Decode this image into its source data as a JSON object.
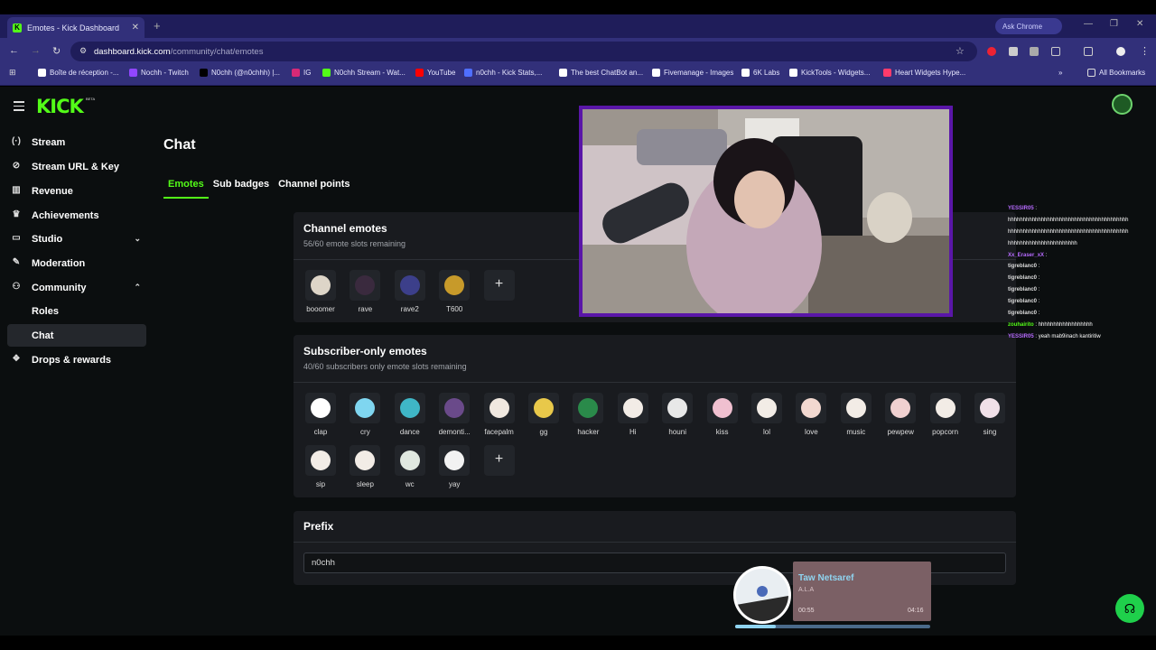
{
  "browser": {
    "tab_title": "Emotes - Kick Dashboard",
    "tab_close": "✕",
    "new_tab": "+",
    "ask_chrome": "Ask Chrome",
    "url_host": "dashboard.kick.com",
    "url_path": "/community/chat/emotes",
    "all_bookmarks": "All Bookmarks",
    "bookmarks": [
      {
        "label": "Boîte de réception -...",
        "color": "#ffffff"
      },
      {
        "label": "Nochh - Twitch",
        "color": "#9146ff"
      },
      {
        "label": "N0chh (@n0chhh) |...",
        "color": "#000000"
      },
      {
        "label": "IG",
        "color": "#d62976"
      },
      {
        "label": "N0chh Stream - Wat...",
        "color": "#53fc18"
      },
      {
        "label": "YouTube",
        "color": "#ff0000"
      },
      {
        "label": "n0chh - Kick Stats,...",
        "color": "#4f6fff"
      },
      {
        "label": "The best ChatBot an...",
        "color": "#ffffff"
      },
      {
        "label": "Fivemanage - Images",
        "color": "#ffffff"
      },
      {
        "label": "6K Labs",
        "color": "#ffffff"
      },
      {
        "label": "KickTools - Widgets...",
        "color": "#ffffff"
      },
      {
        "label": "Heart Widgets Hype...",
        "color": "#ff3b6b"
      }
    ]
  },
  "brand": {
    "logo": "KICK",
    "beta": "BETA",
    "accent": "#53fc18"
  },
  "sidebar": {
    "items": [
      {
        "label": "Stream",
        "icon": "(·)"
      },
      {
        "label": "Stream URL & Key",
        "icon": "⊘"
      },
      {
        "label": "Revenue",
        "icon": "▥"
      },
      {
        "label": "Achievements",
        "icon": "♛"
      },
      {
        "label": "Studio",
        "icon": "▭",
        "chevron": "⌄"
      },
      {
        "label": "Moderation",
        "icon": "✎"
      },
      {
        "label": "Community",
        "icon": "⚇",
        "chevron": "⌃"
      },
      {
        "label": "Roles"
      },
      {
        "label": "Chat"
      },
      {
        "label": "Drops & rewards",
        "icon": "❖"
      }
    ]
  },
  "main": {
    "title": "Chat",
    "tabs": [
      "Emotes",
      "Sub badges",
      "Channel points"
    ],
    "channel_emotes": {
      "title": "Channel emotes",
      "subtitle": "56/60 emote slots remaining",
      "emotes": [
        {
          "name": "booomer",
          "color": "#ddd5c8"
        },
        {
          "name": "rave",
          "color": "#3a2a3e"
        },
        {
          "name": "rave2",
          "color": "#3c3f8a"
        },
        {
          "name": "T600",
          "color": "#c79a2a"
        }
      ],
      "add": "+"
    },
    "subscriber_emotes": {
      "title": "Subscriber-only emotes",
      "subtitle": "40/60 subscribers only emote slots remaining",
      "emotes": [
        {
          "name": "clap",
          "color": "#ffffff"
        },
        {
          "name": "cry",
          "color": "#7fd6f0"
        },
        {
          "name": "dance",
          "color": "#3fb6c6"
        },
        {
          "name": "demonti...",
          "color": "#6a4a8a"
        },
        {
          "name": "facepalm",
          "color": "#f0e8e0"
        },
        {
          "name": "gg",
          "color": "#e8c84a"
        },
        {
          "name": "hacker",
          "color": "#2a8a4a"
        },
        {
          "name": "Hi",
          "color": "#f2ece6"
        },
        {
          "name": "houni",
          "color": "#e8e8e8"
        },
        {
          "name": "kiss",
          "color": "#f0c0d0"
        },
        {
          "name": "lol",
          "color": "#f2ece6"
        },
        {
          "name": "love",
          "color": "#f2d8d0"
        },
        {
          "name": "music",
          "color": "#f2ece6"
        },
        {
          "name": "pewpew",
          "color": "#f0d0d0"
        },
        {
          "name": "popcorn",
          "color": "#f2ece6"
        },
        {
          "name": "sing",
          "color": "#f0e0e8"
        },
        {
          "name": "sip",
          "color": "#f2ece6"
        },
        {
          "name": "sleep",
          "color": "#f2ece6"
        },
        {
          "name": "wc",
          "color": "#e0e8e0"
        },
        {
          "name": "yay",
          "color": "#f2f2f2"
        }
      ],
      "add": "+"
    },
    "prefix": {
      "title": "Prefix",
      "value": "n0chh"
    }
  },
  "chat_overlay": [
    {
      "user": "YESSIR05",
      "text": "",
      "color": "#b76bff"
    },
    {
      "user": "",
      "text": "hhhhhhhhhhhhhhhhhhhhhhhhhhhhhhhhhhhhhhhh",
      "color": "#ffffff"
    },
    {
      "user": "",
      "text": "hhhhhhhhhhhhhhhhhhhhhhhhhhhhhhhhhhhhhhhh",
      "color": "#ffffff"
    },
    {
      "user": "",
      "text": "hhhhhhhhhhhhhhhhhhhhhhh",
      "color": "#ffffff"
    },
    {
      "user": "Xx_Eraser_xX",
      "text": "",
      "color": "#b76bff"
    },
    {
      "user": "tigreblanc0",
      "text": "",
      "color": "#dddddd"
    },
    {
      "user": "tigreblanc0",
      "text": "",
      "color": "#dddddd"
    },
    {
      "user": "tigreblanc0",
      "text": "",
      "color": "#dddddd"
    },
    {
      "user": "tigreblanc0",
      "text": "",
      "color": "#dddddd"
    },
    {
      "user": "tigreblanc0",
      "text": "",
      "color": "#dddddd"
    },
    {
      "user": "zouhairito",
      "text": "hhhhhhhhhhhhhhhhhh",
      "color": "#53fc18"
    },
    {
      "user": "YESSIR05",
      "text": "yeah mab9inach kantiritiw",
      "color": "#b76bff"
    }
  ],
  "music_player": {
    "title": "Taw Netsaref",
    "artist": "A.L.A",
    "elapsed": "00:55",
    "duration": "04:16",
    "progress": 0.21
  }
}
